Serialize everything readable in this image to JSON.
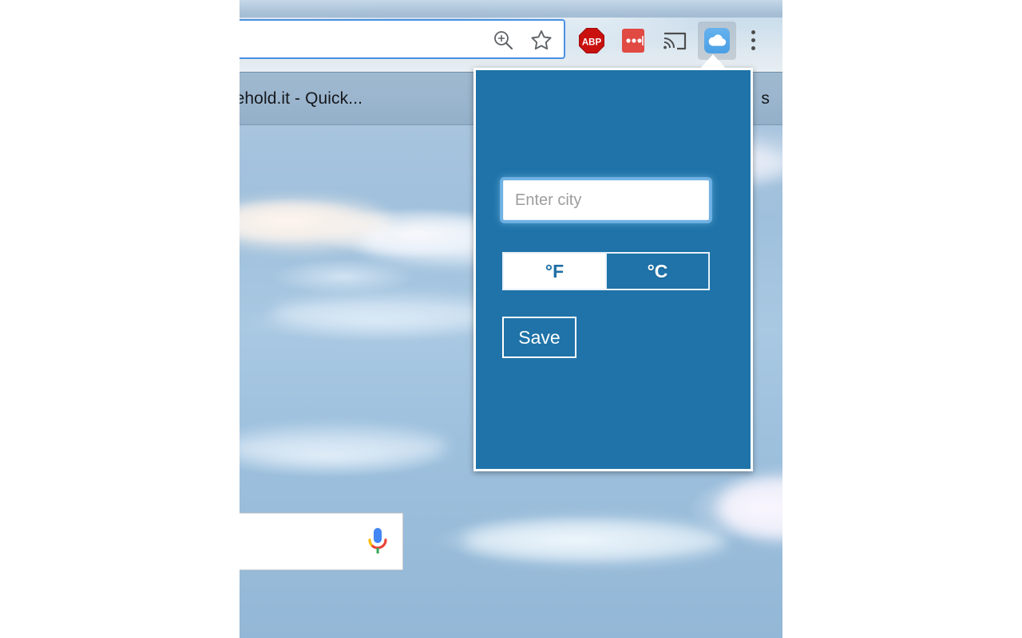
{
  "browser": {
    "omnibox": {
      "value": "",
      "placeholder": ""
    },
    "toolbar_icons": [
      {
        "name": "zoom-icon",
        "label": "Zoom"
      },
      {
        "name": "star-icon",
        "label": "Bookmark this page"
      },
      {
        "name": "adblock-plus-icon",
        "label": "ABP"
      },
      {
        "name": "password-manager-icon",
        "label": "•••"
      },
      {
        "name": "cast-icon",
        "label": "Cast"
      },
      {
        "name": "weather-extension-icon",
        "label": "Weather"
      },
      {
        "name": "chrome-menu-icon",
        "label": "Customize and control Google Chrome"
      }
    ],
    "adblock_label": "ABP",
    "bookmarks": {
      "left_item": "cehold.it - Quick...",
      "right_item": "s"
    }
  },
  "popup": {
    "city_input": {
      "value": "",
      "placeholder": "Enter city"
    },
    "units": {
      "fahrenheit_label": "°F",
      "celsius_label": "°C",
      "selected": "°C"
    },
    "save_label": "Save",
    "colors": {
      "background": "#1f73a8",
      "border": "#ffffff",
      "accent_text": "#1f6fa5"
    }
  },
  "page": {
    "google_search": {
      "value": "",
      "mic_icon": "microphone-icon"
    }
  }
}
